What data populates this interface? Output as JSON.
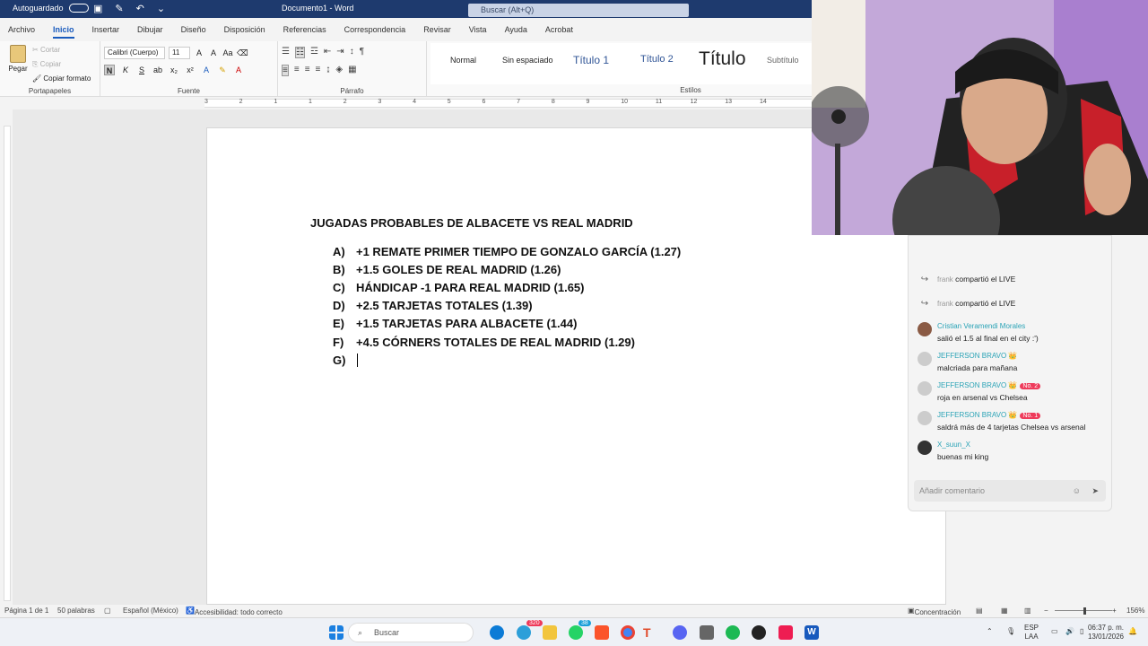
{
  "titlebar": {
    "autosave_label": "Autoguardado",
    "doc_title": "Documento1 - Word",
    "search_placeholder": "Buscar (Alt+Q)"
  },
  "tabs": [
    "Archivo",
    "Inicio",
    "Insertar",
    "Dibujar",
    "Diseño",
    "Disposición",
    "Referencias",
    "Correspondencia",
    "Revisar",
    "Vista",
    "Ayuda",
    "Acrobat"
  ],
  "active_tab": "Inicio",
  "ribbon": {
    "clipboard": {
      "paste": "Pegar",
      "cut": "Cortar",
      "copy": "Copiar",
      "format_painter": "Copiar formato",
      "label": "Portapapeles"
    },
    "font": {
      "family": "Calibri (Cuerpo)",
      "size": "11",
      "label": "Fuente",
      "bold": "N",
      "italic": "K",
      "underline": "S"
    },
    "paragraph": {
      "label": "Párrafo"
    },
    "styles": {
      "label": "Estilos",
      "items": [
        "Normal",
        "Sin espaciado",
        "Título 1",
        "Título 2",
        "Título",
        "Subtítulo"
      ]
    }
  },
  "ruler": {
    "numbers": [
      "3",
      "2",
      "1",
      "1",
      "2",
      "3",
      "4",
      "5",
      "6",
      "7",
      "8",
      "9",
      "10",
      "11",
      "12",
      "13",
      "14"
    ]
  },
  "document": {
    "title": "JUGADAS PROBABLES DE ALBACETE VS REAL MADRID",
    "items": [
      {
        "letter": "A)",
        "text": "+1 REMATE PRIMER TIEMPO DE GONZALO GARCÍA (1.27)"
      },
      {
        "letter": "B)",
        "text": "+1.5 GOLES DE REAL MADRID (1.26)"
      },
      {
        "letter": "C)",
        "text": "HÁNDICAP -1 PARA REAL MADRID (1.65)"
      },
      {
        "letter": "D)",
        "text": "+2.5 TARJETAS TOTALES (1.39)"
      },
      {
        "letter": "E)",
        "text": "+1.5 TARJETAS PARA ALBACETE (1.44)"
      },
      {
        "letter": "F)",
        "text": "+4.5 CÓRNERS TOTALES DE REAL MADRID (1.29)"
      },
      {
        "letter": "G)",
        "text": ""
      }
    ]
  },
  "chat": {
    "messages": [
      {
        "type": "share",
        "user": "frank",
        "text": "compartió el LIVE"
      },
      {
        "type": "share",
        "user": "frank",
        "text": "compartió el LIVE"
      },
      {
        "type": "msg",
        "user": "Cristian Veramendi Morales",
        "text": "salió el 1.5 al final en el city :')",
        "badge": ""
      },
      {
        "type": "msg",
        "user": "JEFFERSON BRAVO",
        "text": "malcriada para mañana",
        "badge": ""
      },
      {
        "type": "msg",
        "user": "JEFFERSON BRAVO",
        "text": "roja en arsenal vs Chelsea",
        "badge": "No. 2"
      },
      {
        "type": "msg",
        "user": "JEFFERSON BRAVO",
        "text": "saldrá más de 4 tarjetas Chelsea vs arsenal",
        "badge": "No. 1"
      },
      {
        "type": "msg",
        "user": "X_suun_X",
        "text": "buenas mi king",
        "badge": ""
      }
    ],
    "input_placeholder": "Añadir comentario"
  },
  "statusbar": {
    "page": "Página 1 de 1",
    "words": "50 palabras",
    "language": "Español (México)",
    "accessibility": "Accesibilidad: todo correcto",
    "focus": "Concentración",
    "zoom": "156%"
  },
  "taskbar": {
    "search": "Buscar",
    "lang_top": "ESP",
    "lang_bottom": "LAA",
    "time": "06:37 p. m.",
    "date": "13/01/2026",
    "badge_a": "320",
    "badge_b": "38"
  },
  "colors": {
    "accent": "#185abd",
    "titlebar": "#1e3a6e",
    "chat_name": "#2aa3b6"
  }
}
